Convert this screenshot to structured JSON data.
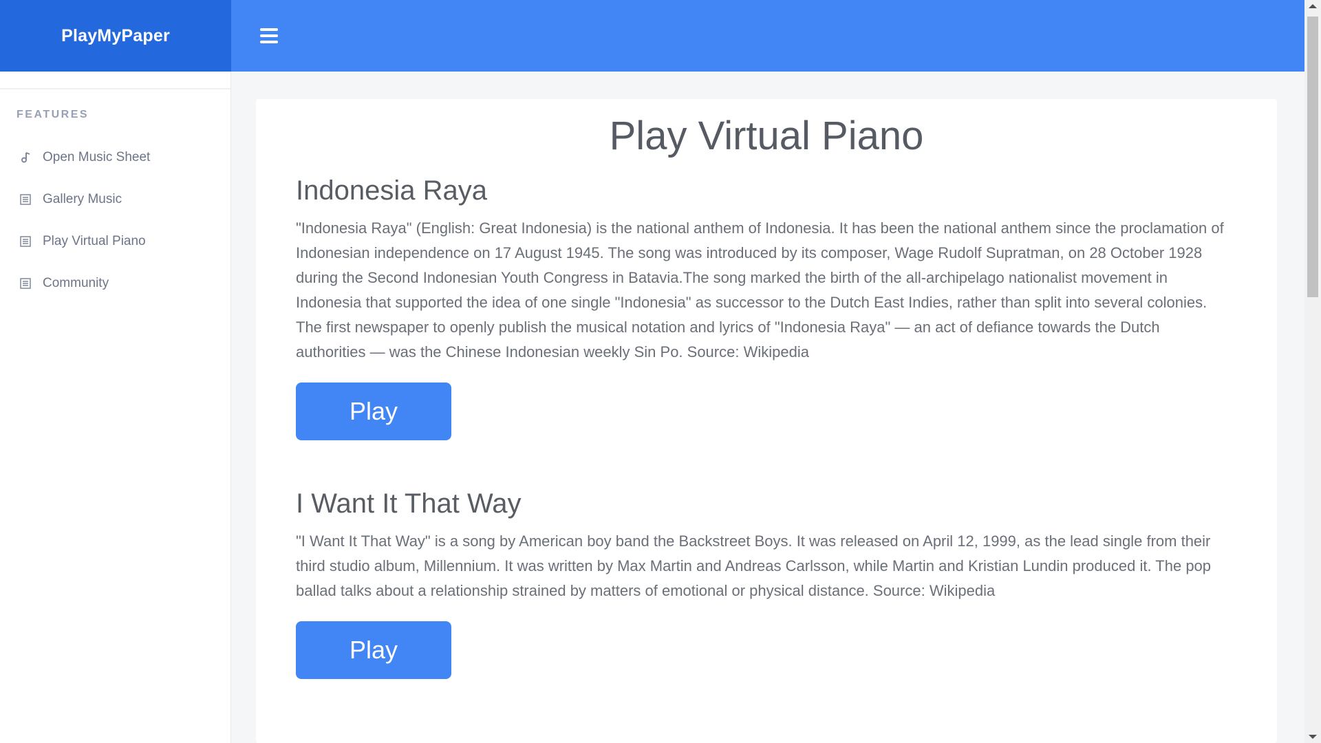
{
  "brand": {
    "name": "PlayMyPaper"
  },
  "navbar": {
    "menu_icon": "hamburger-icon"
  },
  "sidebar": {
    "section_title": "FEATURES",
    "items": [
      {
        "label": "Open Music Sheet",
        "icon": "music-note-icon"
      },
      {
        "label": "Gallery Music",
        "icon": "list-icon"
      },
      {
        "label": "Play Virtual Piano",
        "icon": "list-icon"
      },
      {
        "label": "Community",
        "icon": "list-icon"
      }
    ]
  },
  "main": {
    "title": "Play Virtual Piano",
    "songs": [
      {
        "title": "Indonesia Raya",
        "description": "\"Indonesia Raya\" (English: Great Indonesia) is the national anthem of Indonesia. It has been the national anthem since the proclamation of Indonesian independence on 17 August 1945. The song was introduced by its composer, Wage Rudolf Supratman, on 28 October 1928 during the Second Indonesian Youth Congress in Batavia.The song marked the birth of the all-archipelago nationalist movement in Indonesia that supported the idea of one single \"Indonesia\" as successor to the Dutch East Indies, rather than split into several colonies. The first newspaper to openly publish the musical notation and lyrics of \"Indonesia Raya\" — an act of defiance towards the Dutch authorities — was the Chinese Indonesian weekly Sin Po. Source: Wikipedia",
        "button": "Play"
      },
      {
        "title": "I Want It That Way",
        "description": "\"I Want It That Way\" is a song by American boy band the Backstreet Boys. It was released on April 12, 1999, as the lead single from their third studio album, Millennium. It was written by Max Martin and Andreas Carlsson, while Martin and Kristian Lundin produced it. The pop ballad talks about a relationship strained by matters of emotional or physical distance. Source: Wikipedia",
        "button": "Play"
      }
    ]
  },
  "colors": {
    "brand_bg": "#2468de",
    "navbar_bg": "#4285f4",
    "button_bg": "#4285f4"
  }
}
